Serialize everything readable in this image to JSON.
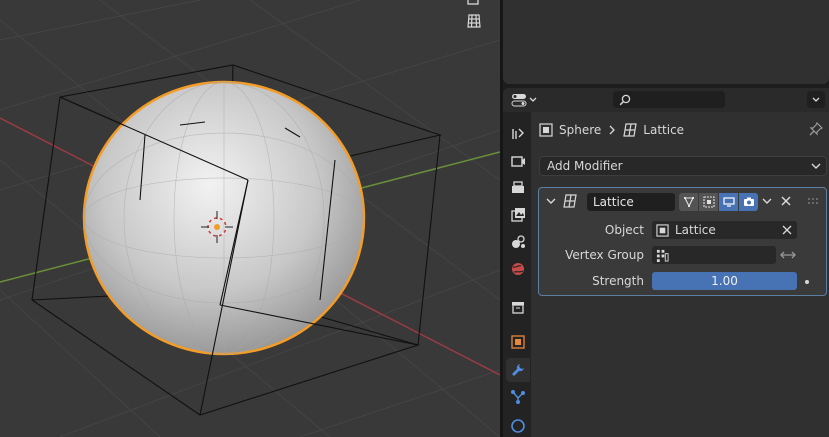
{
  "breadcrumb": {
    "object": "Sphere",
    "modifier": "Lattice"
  },
  "add_modifier_label": "Add Modifier",
  "modifier": {
    "name": "Lattice",
    "object_label": "Object",
    "object_value": "Lattice",
    "vertex_group_label": "Vertex Group",
    "vertex_group_value": "",
    "strength_label": "Strength",
    "strength_value": "1.00"
  },
  "colors": {
    "accent": "#4772b3",
    "selection": "#f39c27",
    "panel": "#303030"
  },
  "icons": {
    "tabs": [
      "tool-icon",
      "render-icon",
      "output-icon",
      "view-layer-icon",
      "scene-icon",
      "world-icon",
      "collection-icon",
      "object-icon",
      "modifier-wrench-icon",
      "particles-icon",
      "physics-icon"
    ]
  }
}
